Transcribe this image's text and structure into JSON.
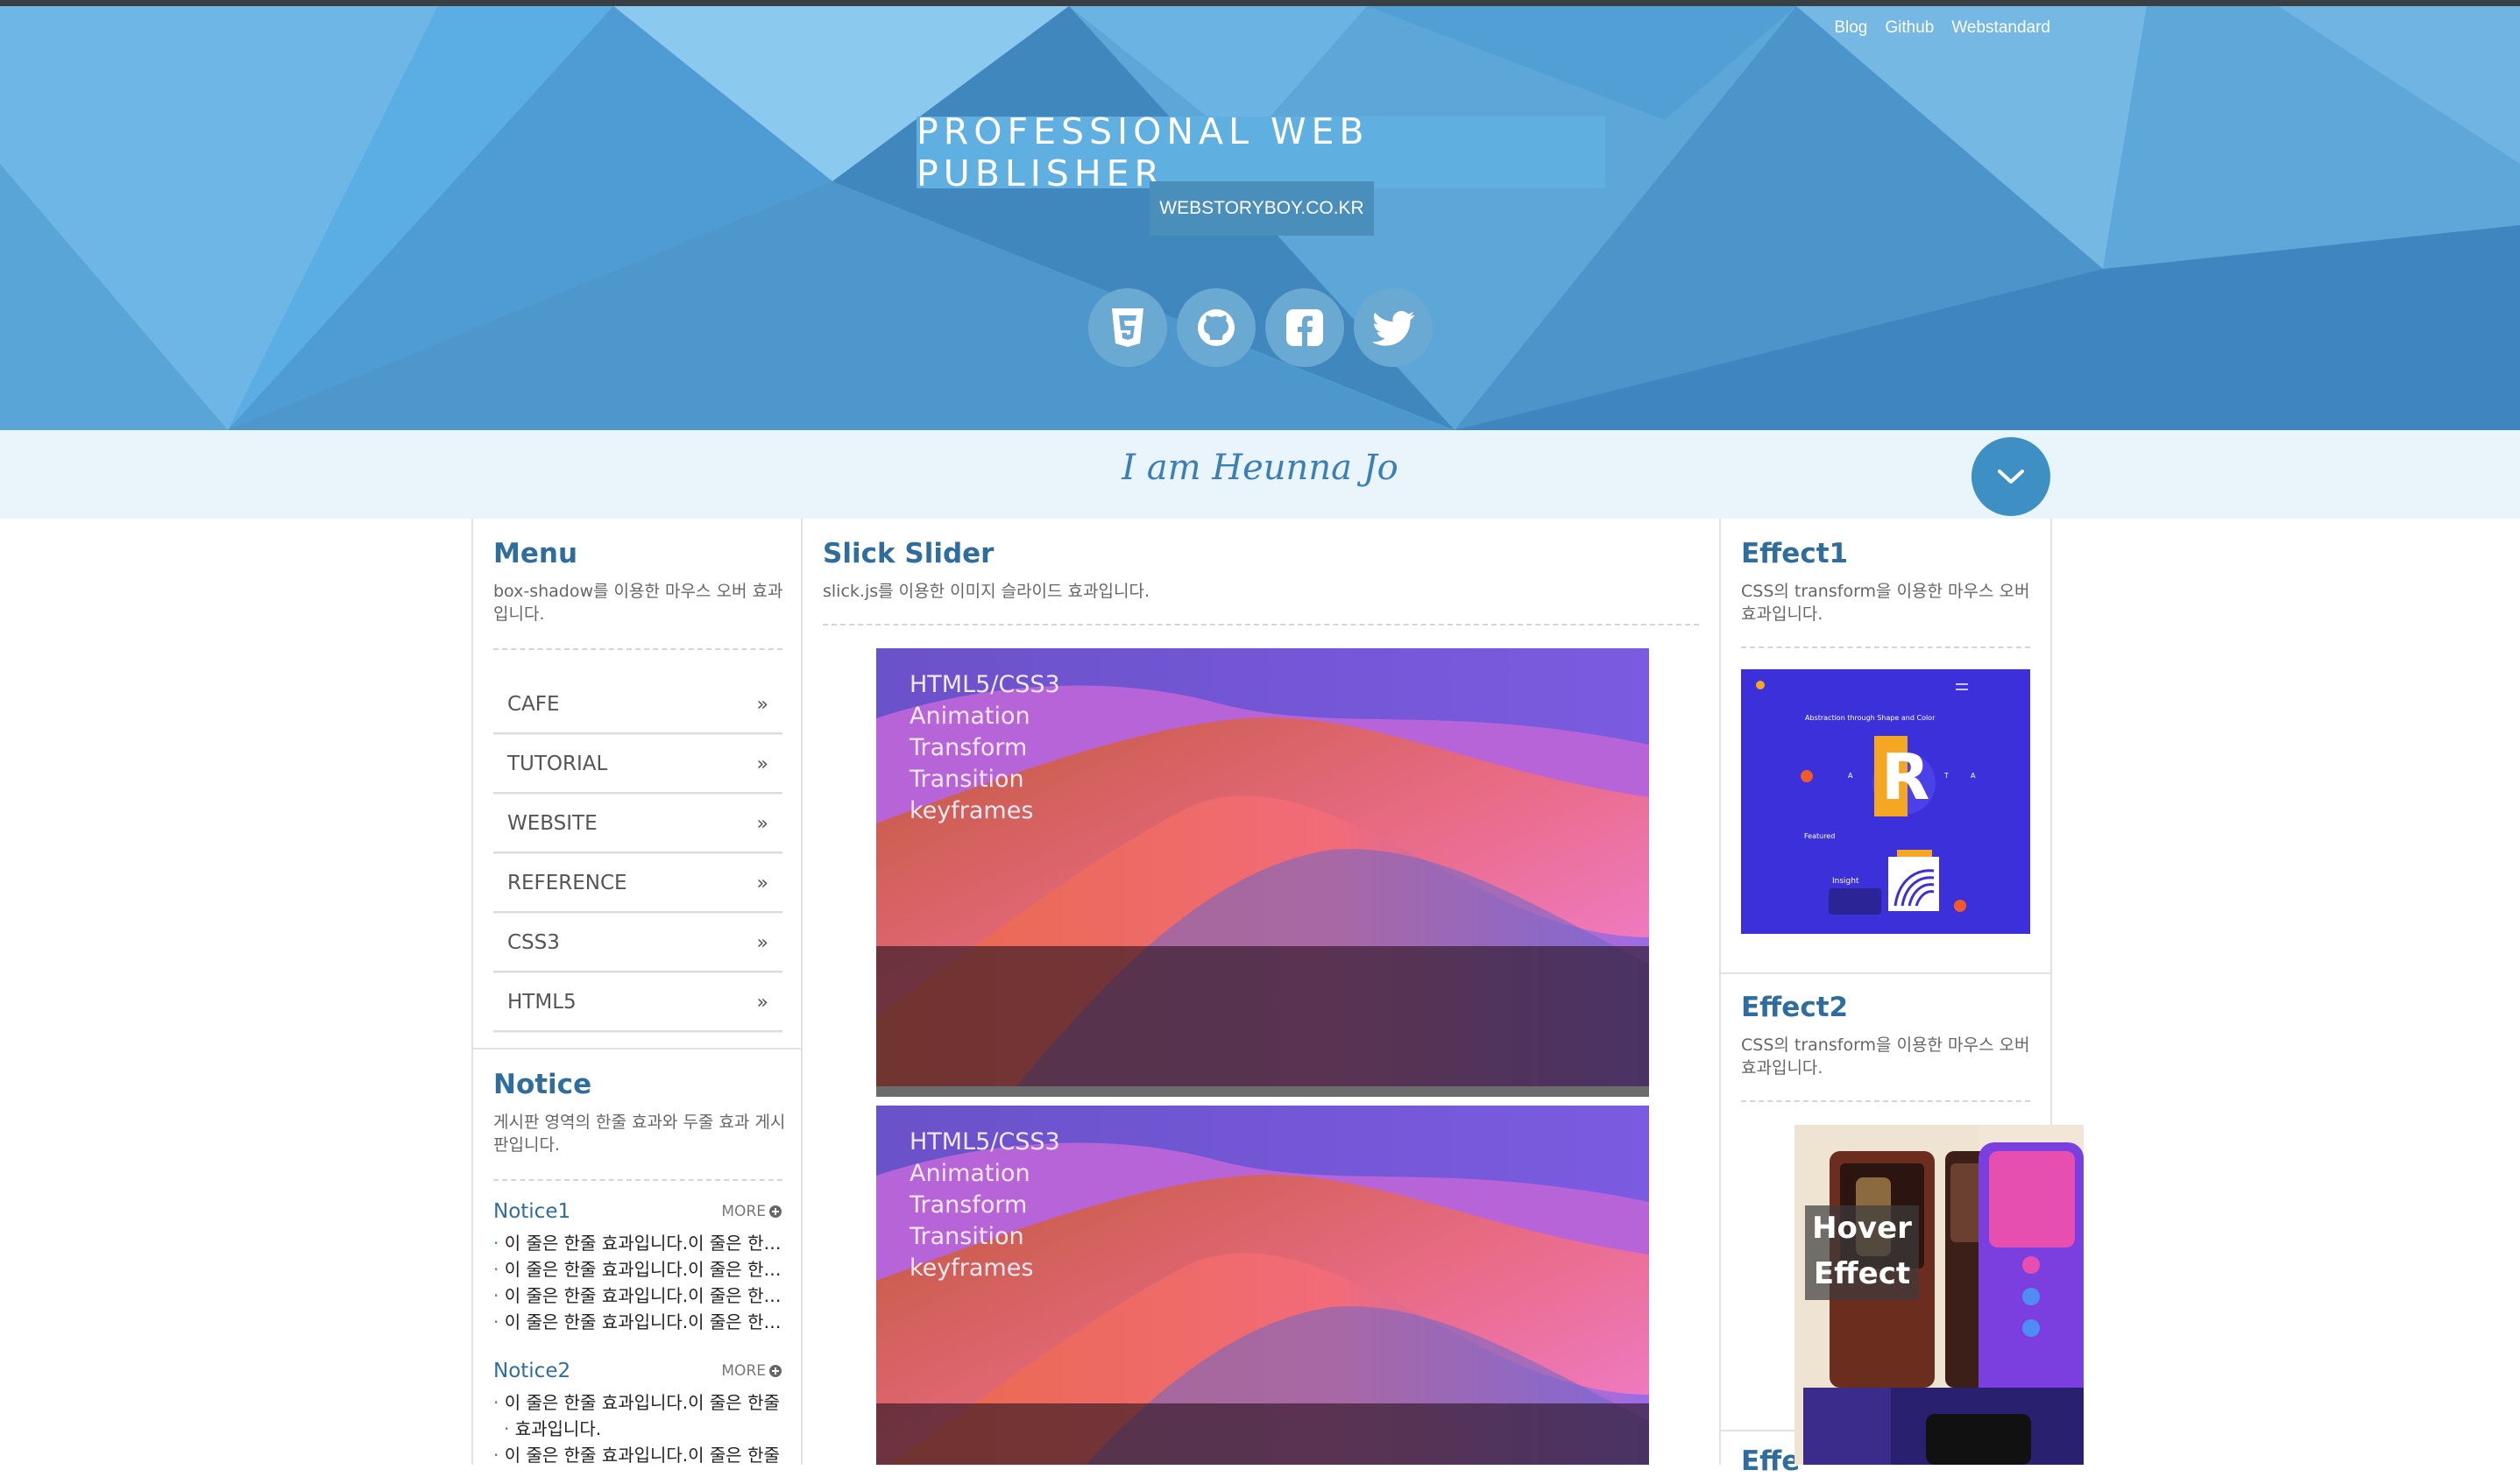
{
  "header": {
    "links": [
      "Blog",
      "Github",
      "Webstandard"
    ],
    "title": "PROFESSIONAL WEB PUBLISHER",
    "subtitle": "WEBSTORYBOY.CO.KR",
    "socials": [
      "html5-icon",
      "github-icon",
      "facebook-icon",
      "twitter-icon"
    ]
  },
  "intro": {
    "text": "I am Heunna Jo"
  },
  "menu": {
    "title": "Menu",
    "desc": "box-shadow를 이용한 마우스 오버 효과입니다.",
    "items": [
      "CAFE",
      "TUTORIAL",
      "WEBSITE",
      "REFERENCE",
      "CSS3",
      "HTML5"
    ]
  },
  "notice": {
    "title": "Notice",
    "desc": "게시판 영역의 한줄 효과와 두줄 효과 게시판입니다.",
    "more": "MORE",
    "blocks": [
      {
        "title": "Notice1",
        "lines": [
          "이 줄은 한줄 효과입니다.이 줄은 한줄 효과입니다.",
          "이 줄은 한줄 효과입니다.이 줄은 한줄 효과입니다.",
          "이 줄은 한줄 효과입니다.이 줄은 한줄 효과입니다.",
          "이 줄은 한줄 효과입니다.이 줄은 한줄 효과입니다."
        ]
      },
      {
        "title": "Notice2",
        "lines": [
          "이 줄은 한줄 효과입니다.이 줄은 한줄",
          "효과입니다.",
          "이 줄은 한줄 효과입니다.이 줄은 한줄"
        ]
      }
    ]
  },
  "slider": {
    "title": "Slick Slider",
    "desc": "slick.js를 이용한 이미지 슬라이드 효과입니다.",
    "slide_lines": [
      "HTML5/CSS3",
      "Animation",
      "Transform",
      "Transition",
      "keyframes"
    ]
  },
  "effect1": {
    "title": "Effect1",
    "desc": "CSS의 transform을 이용한 마우스 오버효과입니다.",
    "card_heading": "Abstraction through Shape and Color",
    "card_letter": "R",
    "card_letters_side": [
      "A",
      "T",
      "A"
    ],
    "card_featured": "Featured",
    "card_insight": "Insight"
  },
  "effect2": {
    "title": "Effect2",
    "desc": "CSS의 transform을 이용한 마우스 오버효과입니다.",
    "hover_line1": "Hover",
    "hover_line2": "Effect"
  },
  "effect3": {
    "title_partial": "Effe"
  },
  "colors": {
    "header_blue": "#4f9fd3",
    "title_box": "#5fb0e1",
    "intro_bg": "#e9f4fb",
    "accent": "#2f6d9f"
  }
}
